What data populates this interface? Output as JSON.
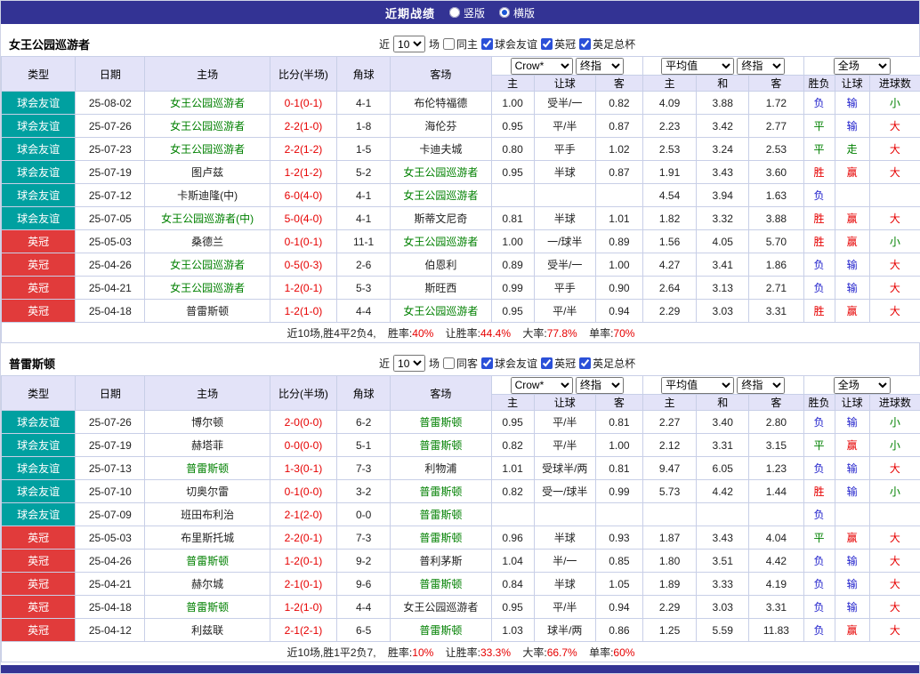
{
  "topbar": {
    "title": "近期战绩",
    "radio_vertical": "竖版",
    "radio_horizontal": "横版"
  },
  "colors": {
    "topbar_bg": "#333394",
    "header_bg": "#e3e3f8",
    "border": "#c8cfe7",
    "friendly_bg": "#00a0a0",
    "championship_bg": "#e13b3b",
    "self_team": "#008000",
    "score_red": "#e60000"
  },
  "result_colors": {
    "胜": "#e60000",
    "平": "#008000",
    "负": "#2222cc",
    "赢": "#e60000",
    "走": "#008000",
    "输": "#2222cc",
    "大": "#e60000",
    "小": "#008000"
  },
  "controls": {
    "near_label": "近",
    "games_value": "10",
    "games_label": "场",
    "bookmaker": "Crow*",
    "final_label": "终指",
    "average_label": "平均值",
    "fulltime_label": "全场"
  },
  "columns": {
    "type": "类型",
    "date": "日期",
    "home": "主场",
    "score": "比分(半场)",
    "corner": "角球",
    "away": "客场",
    "odds_home": "主",
    "odds_handicap": "让球",
    "odds_away": "客",
    "avg_home": "主",
    "avg_draw": "和",
    "avg_away": "客",
    "res_wdl": "胜负",
    "res_handicap": "让球",
    "res_goals": "进球数"
  },
  "sections": [
    {
      "team": "女王公园巡游者",
      "filters": {
        "same_label": "同主",
        "leagues": [
          {
            "label": "球会友谊",
            "checked": true
          },
          {
            "label": "英冠",
            "checked": true
          },
          {
            "label": "英足总杯",
            "checked": true
          }
        ]
      },
      "rows": [
        {
          "type": "球会友谊",
          "league": "friendly",
          "date": "25-08-02",
          "home": "女王公园巡游者",
          "home_self": true,
          "score": "0-1(0-1)",
          "corner": "4-1",
          "away": "布伦特福德",
          "away_self": false,
          "odds": [
            "1.00",
            "受半/一",
            "0.82"
          ],
          "avg": [
            "4.09",
            "3.88",
            "1.72"
          ],
          "result": "负",
          "handicap": "输",
          "goals": "小"
        },
        {
          "type": "球会友谊",
          "league": "friendly",
          "date": "25-07-26",
          "home": "女王公园巡游者",
          "home_self": true,
          "score": "2-2(1-0)",
          "corner": "1-8",
          "away": "海伦芬",
          "away_self": false,
          "odds": [
            "0.95",
            "平/半",
            "0.87"
          ],
          "avg": [
            "2.23",
            "3.42",
            "2.77"
          ],
          "result": "平",
          "handicap": "输",
          "goals": "大"
        },
        {
          "type": "球会友谊",
          "league": "friendly",
          "date": "25-07-23",
          "home": "女王公园巡游者",
          "home_self": true,
          "score": "2-2(1-2)",
          "corner": "1-5",
          "away": "卡迪夫城",
          "away_self": false,
          "odds": [
            "0.80",
            "平手",
            "1.02"
          ],
          "avg": [
            "2.53",
            "3.24",
            "2.53"
          ],
          "result": "平",
          "handicap": "走",
          "goals": "大"
        },
        {
          "type": "球会友谊",
          "league": "friendly",
          "date": "25-07-19",
          "home": "图卢兹",
          "home_self": false,
          "score": "1-2(1-2)",
          "corner": "5-2",
          "away": "女王公园巡游者",
          "away_self": true,
          "odds": [
            "0.95",
            "半球",
            "0.87"
          ],
          "avg": [
            "1.91",
            "3.43",
            "3.60"
          ],
          "result": "胜",
          "handicap": "赢",
          "goals": "大"
        },
        {
          "type": "球会友谊",
          "league": "friendly",
          "date": "25-07-12",
          "home": "卡斯迪隆(中)",
          "home_self": false,
          "score": "6-0(4-0)",
          "corner": "4-1",
          "away": "女王公园巡游者",
          "away_self": true,
          "odds": [
            "",
            "",
            ""
          ],
          "avg": [
            "4.54",
            "3.94",
            "1.63"
          ],
          "result": "负",
          "handicap": "",
          "goals": ""
        },
        {
          "type": "球会友谊",
          "league": "friendly",
          "date": "25-07-05",
          "home": "女王公园巡游者(中)",
          "home_self": true,
          "score": "5-0(4-0)",
          "corner": "4-1",
          "away": "斯蒂文尼奇",
          "away_self": false,
          "odds": [
            "0.81",
            "半球",
            "1.01"
          ],
          "avg": [
            "1.82",
            "3.32",
            "3.88"
          ],
          "result": "胜",
          "handicap": "赢",
          "goals": "大"
        },
        {
          "type": "英冠",
          "league": "championship",
          "date": "25-05-03",
          "home": "桑德兰",
          "home_self": false,
          "score": "0-1(0-1)",
          "corner": "11-1",
          "away": "女王公园巡游者",
          "away_self": true,
          "odds": [
            "1.00",
            "一/球半",
            "0.89"
          ],
          "avg": [
            "1.56",
            "4.05",
            "5.70"
          ],
          "result": "胜",
          "handicap": "赢",
          "goals": "小"
        },
        {
          "type": "英冠",
          "league": "championship",
          "date": "25-04-26",
          "home": "女王公园巡游者",
          "home_self": true,
          "score": "0-5(0-3)",
          "corner": "2-6",
          "away": "伯恩利",
          "away_self": false,
          "odds": [
            "0.89",
            "受半/一",
            "1.00"
          ],
          "avg": [
            "4.27",
            "3.41",
            "1.86"
          ],
          "result": "负",
          "handicap": "输",
          "goals": "大"
        },
        {
          "type": "英冠",
          "league": "championship",
          "date": "25-04-21",
          "home": "女王公园巡游者",
          "home_self": true,
          "score": "1-2(0-1)",
          "corner": "5-3",
          "away": "斯旺西",
          "away_self": false,
          "odds": [
            "0.99",
            "平手",
            "0.90"
          ],
          "avg": [
            "2.64",
            "3.13",
            "2.71"
          ],
          "result": "负",
          "handicap": "输",
          "goals": "大"
        },
        {
          "type": "英冠",
          "league": "championship",
          "date": "25-04-18",
          "home": "普雷斯顿",
          "home_self": false,
          "score": "1-2(1-0)",
          "corner": "4-4",
          "away": "女王公园巡游者",
          "away_self": true,
          "odds": [
            "0.95",
            "平/半",
            "0.94"
          ],
          "avg": [
            "2.29",
            "3.03",
            "3.31"
          ],
          "result": "胜",
          "handicap": "赢",
          "goals": "大"
        }
      ],
      "summary": {
        "prefix": "近10场,胜4平2负4,",
        "stats": [
          {
            "label": "胜率:",
            "value": "40%"
          },
          {
            "label": "让胜率:",
            "value": "44.4%"
          },
          {
            "label": "大率:",
            "value": "77.8%"
          },
          {
            "label": "单率:",
            "value": "70%"
          }
        ]
      }
    },
    {
      "team": "普雷斯顿",
      "filters": {
        "same_label": "同客",
        "leagues": [
          {
            "label": "球会友谊",
            "checked": true
          },
          {
            "label": "英冠",
            "checked": true
          },
          {
            "label": "英足总杯",
            "checked": true
          }
        ]
      },
      "rows": [
        {
          "type": "球会友谊",
          "league": "friendly",
          "date": "25-07-26",
          "home": "博尔顿",
          "home_self": false,
          "score": "2-0(0-0)",
          "corner": "6-2",
          "away": "普雷斯顿",
          "away_self": true,
          "odds": [
            "0.95",
            "平/半",
            "0.81"
          ],
          "avg": [
            "2.27",
            "3.40",
            "2.80"
          ],
          "result": "负",
          "handicap": "输",
          "goals": "小"
        },
        {
          "type": "球会友谊",
          "league": "friendly",
          "date": "25-07-19",
          "home": "赫塔菲",
          "home_self": false,
          "score": "0-0(0-0)",
          "corner": "5-1",
          "away": "普雷斯顿",
          "away_self": true,
          "odds": [
            "0.82",
            "平/半",
            "1.00"
          ],
          "avg": [
            "2.12",
            "3.31",
            "3.15"
          ],
          "result": "平",
          "handicap": "赢",
          "goals": "小"
        },
        {
          "type": "球会友谊",
          "league": "friendly",
          "date": "25-07-13",
          "home": "普雷斯顿",
          "home_self": true,
          "score": "1-3(0-1)",
          "corner": "7-3",
          "away": "利物浦",
          "away_self": false,
          "odds": [
            "1.01",
            "受球半/两",
            "0.81"
          ],
          "avg": [
            "9.47",
            "6.05",
            "1.23"
          ],
          "result": "负",
          "handicap": "输",
          "goals": "大"
        },
        {
          "type": "球会友谊",
          "league": "friendly",
          "date": "25-07-10",
          "home": "切奥尔雷",
          "home_self": false,
          "score": "0-1(0-0)",
          "corner": "3-2",
          "away": "普雷斯顿",
          "away_self": true,
          "odds": [
            "0.82",
            "受一/球半",
            "0.99"
          ],
          "avg": [
            "5.73",
            "4.42",
            "1.44"
          ],
          "result": "胜",
          "handicap": "输",
          "goals": "小"
        },
        {
          "type": "球会友谊",
          "league": "friendly",
          "date": "25-07-09",
          "home": "班田布利治",
          "home_self": false,
          "score": "2-1(2-0)",
          "corner": "0-0",
          "away": "普雷斯顿",
          "away_self": true,
          "odds": [
            "",
            "",
            ""
          ],
          "avg": [
            "",
            "",
            ""
          ],
          "result": "负",
          "handicap": "",
          "goals": ""
        },
        {
          "type": "英冠",
          "league": "championship",
          "date": "25-05-03",
          "home": "布里斯托城",
          "home_self": false,
          "score": "2-2(0-1)",
          "corner": "7-3",
          "away": "普雷斯顿",
          "away_self": true,
          "odds": [
            "0.96",
            "半球",
            "0.93"
          ],
          "avg": [
            "1.87",
            "3.43",
            "4.04"
          ],
          "result": "平",
          "handicap": "赢",
          "goals": "大"
        },
        {
          "type": "英冠",
          "league": "championship",
          "date": "25-04-26",
          "home": "普雷斯顿",
          "home_self": true,
          "score": "1-2(0-1)",
          "corner": "9-2",
          "away": "普利茅斯",
          "away_self": false,
          "odds": [
            "1.04",
            "半/一",
            "0.85"
          ],
          "avg": [
            "1.80",
            "3.51",
            "4.42"
          ],
          "result": "负",
          "handicap": "输",
          "goals": "大"
        },
        {
          "type": "英冠",
          "league": "championship",
          "date": "25-04-21",
          "home": "赫尔城",
          "home_self": false,
          "score": "2-1(0-1)",
          "corner": "9-6",
          "away": "普雷斯顿",
          "away_self": true,
          "odds": [
            "0.84",
            "半球",
            "1.05"
          ],
          "avg": [
            "1.89",
            "3.33",
            "4.19"
          ],
          "result": "负",
          "handicap": "输",
          "goals": "大"
        },
        {
          "type": "英冠",
          "league": "championship",
          "date": "25-04-18",
          "home": "普雷斯顿",
          "home_self": true,
          "score": "1-2(1-0)",
          "corner": "4-4",
          "away": "女王公园巡游者",
          "away_self": false,
          "odds": [
            "0.95",
            "平/半",
            "0.94"
          ],
          "avg": [
            "2.29",
            "3.03",
            "3.31"
          ],
          "result": "负",
          "handicap": "输",
          "goals": "大"
        },
        {
          "type": "英冠",
          "league": "championship",
          "date": "25-04-12",
          "home": "利兹联",
          "home_self": false,
          "score": "2-1(2-1)",
          "corner": "6-5",
          "away": "普雷斯顿",
          "away_self": true,
          "odds": [
            "1.03",
            "球半/两",
            "0.86"
          ],
          "avg": [
            "1.25",
            "5.59",
            "11.83"
          ],
          "result": "负",
          "handicap": "赢",
          "goals": "大"
        }
      ],
      "summary": {
        "prefix": "近10场,胜1平2负7,",
        "stats": [
          {
            "label": "胜率:",
            "value": "10%"
          },
          {
            "label": "让胜率:",
            "value": "33.3%"
          },
          {
            "label": "大率:",
            "value": "66.7%"
          },
          {
            "label": "单率:",
            "value": "60%"
          }
        ]
      }
    }
  ]
}
